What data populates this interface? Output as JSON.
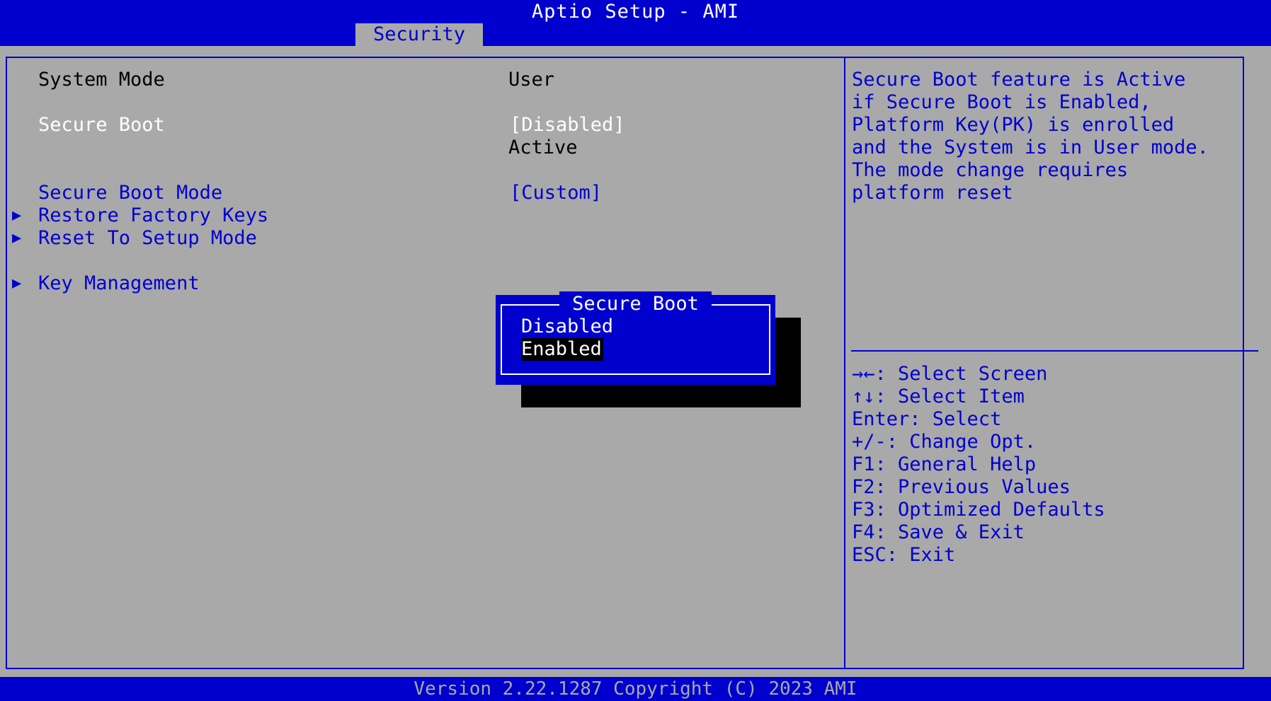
{
  "header": {
    "title": "Aptio Setup - AMI",
    "tab": "Security"
  },
  "settings": {
    "system_mode_label": "System Mode",
    "system_mode_value": "User",
    "secure_boot_label": "Secure Boot",
    "secure_boot_value": "[Disabled]",
    "secure_boot_status": "Active",
    "secure_boot_mode_label": "Secure Boot Mode",
    "secure_boot_mode_value": "[Custom]",
    "restore_factory_keys": "Restore Factory Keys",
    "reset_to_setup_mode": "Reset To Setup Mode",
    "key_management": "Key Management"
  },
  "help": {
    "lines": [
      "Secure Boot feature is Active",
      "if Secure Boot is Enabled,",
      "Platform Key(PK) is enrolled",
      "and the System is in User mode.",
      "The mode change requires",
      "platform reset"
    ]
  },
  "keys": [
    "→←: Select Screen",
    "↑↓: Select Item",
    "Enter: Select",
    "+/-: Change Opt.",
    "F1: General Help",
    "F2: Previous Values",
    "F3: Optimized Defaults",
    "F4: Save & Exit",
    "ESC: Exit"
  ],
  "popup": {
    "title": "Secure Boot",
    "options": [
      "Disabled",
      "Enabled"
    ],
    "selected": "Enabled"
  },
  "footer": {
    "text": "Version 2.22.1287 Copyright (C) 2023 AMI"
  },
  "colors": {
    "background_blue": "#0000ce",
    "panel_gray": "#a9a9a9",
    "text_black": "#000000",
    "text_white": "#ffffff"
  },
  "icons": {
    "submenu": "triangle-right-icon"
  }
}
